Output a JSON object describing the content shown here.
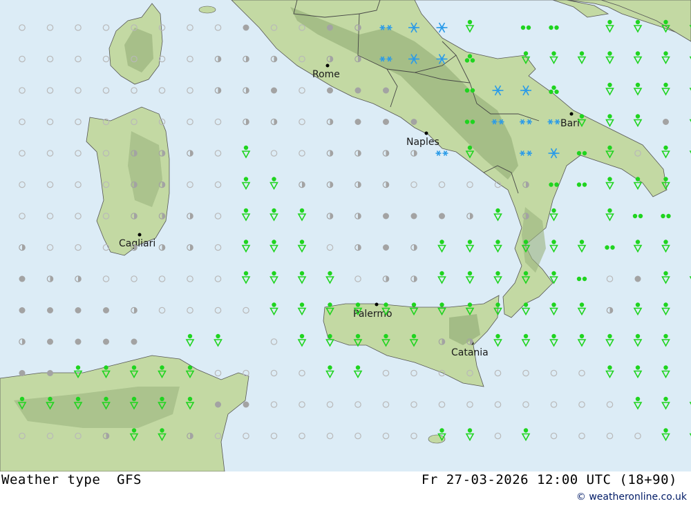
{
  "footer": {
    "product": "Weather type",
    "model": "GFS",
    "valid_time": "Fr 27-03-2026 12:00 UTC (18+90)",
    "credit": "© weatheronline.co.uk"
  },
  "colors": {
    "sea": "#dcecf6",
    "land": "#c3d9a3",
    "mountain": "#9bb47e",
    "rain": "#1fd41f",
    "snow": "#2b9be8",
    "cloud": "#a3a3a3",
    "clear": "#b8b8b8"
  },
  "cities": [
    {
      "name": "Rome"
    },
    {
      "name": "Naples"
    },
    {
      "name": "Bari"
    },
    {
      "name": "Cagliari"
    },
    {
      "name": "Palermo"
    },
    {
      "name": "Catania"
    }
  ],
  "legend_symbols": {
    "o": "clear-sky",
    "h": "half-cloudy",
    "c": "cloudy",
    "r": "rain-shower",
    "d": "drizzle",
    "t": "heavy-rain",
    "s": "snow",
    "S": "heavy-snow"
  },
  "grid_rows": [
    "oooooooocoochsSSr dd rrrrrr",
    "ooooooohhhohhsSSt rrrrrrrr",
    "ooooooohhcoccc  dSSt rrrr",
    "oooooooohhohccc dsssrrrcr",
    "oooohhhoroohhhhsr sSdrorr",
    "oooohhoorrhhhhoooohddrrr",
    "oooohhhorrrhhccchrhr rdd",
    "hooohhhorrrohchrrrrrrdrr",
    "chhooooorrrrohhrrrrrdocrr",
    "cccchoooorrrrrrrrrrrrhrr",
    "hcccc rr orrrrrhhrrrrrrr",
    "ccrrrrroooorroooooooorrr",
    "rrrrrrrccooooooooooooorrr",
    "ooohrrhoooooooorroroooorr"
  ]
}
